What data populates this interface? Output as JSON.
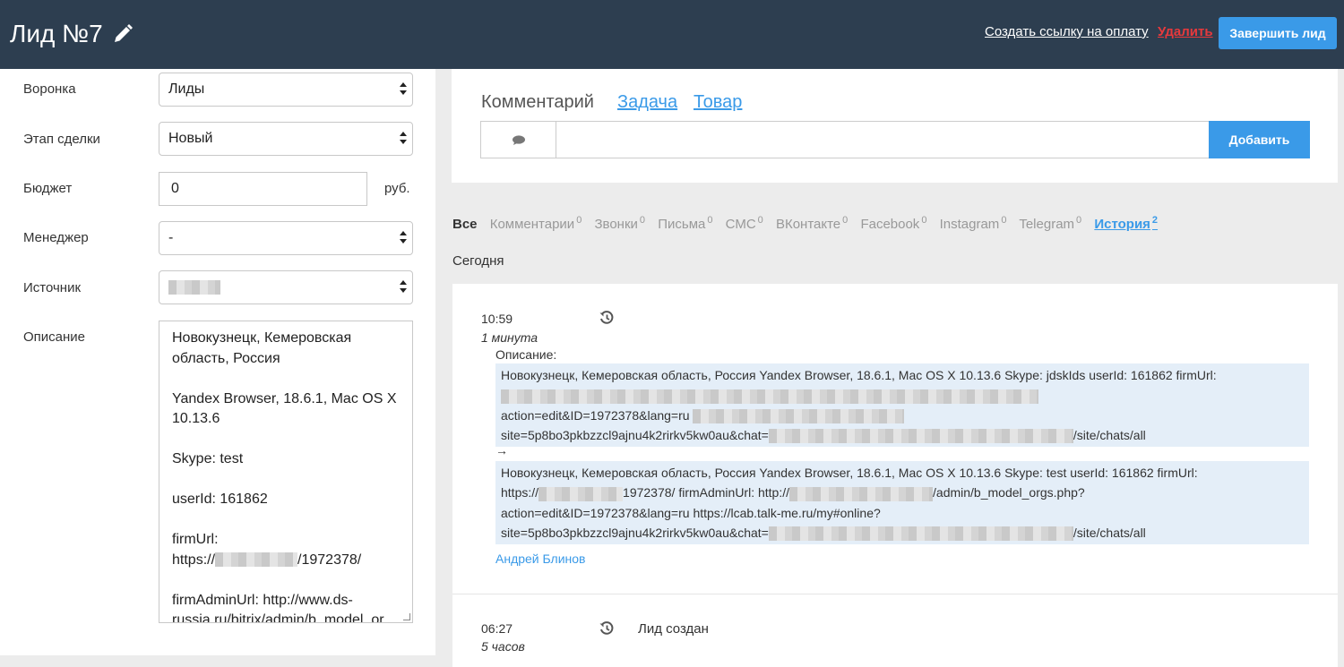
{
  "header": {
    "title": "Лид №7",
    "create_payment_link": "Создать ссылку на оплату",
    "delete_link": "Удалить",
    "finish_button": "Завершить лид"
  },
  "form": {
    "funnel": {
      "label": "Воронка",
      "value": "Лиды"
    },
    "stage": {
      "label": "Этап сделки",
      "value": "Новый"
    },
    "budget": {
      "label": "Бюджет",
      "value": "0",
      "unit": "руб."
    },
    "manager": {
      "label": "Менеджер",
      "value": "-"
    },
    "source": {
      "label": "Источник"
    },
    "description": {
      "label": "Описание",
      "lines": [
        "Новокузнецк, Кемеровская область, Россия",
        "Yandex Browser, 18.6.1, Mac OS X 10.13.6",
        "Skype: test",
        "userId: 161862",
        "firmUrl:",
        "/1972378/",
        "firmAdminUrl: http://www.ds-russia.ru/bitrix/admin/b_model_or"
      ],
      "https_prefix": "https://"
    }
  },
  "comment": {
    "tabs": [
      "Комментарий",
      "Задача",
      "Товар"
    ],
    "input_value": "",
    "input_placeholder": "",
    "add_button": "Добавить"
  },
  "filters": [
    {
      "label": "Все",
      "count": ""
    },
    {
      "label": "Комментарии",
      "count": "0"
    },
    {
      "label": "Звонки",
      "count": "0"
    },
    {
      "label": "Письма",
      "count": "0"
    },
    {
      "label": "СМС",
      "count": "0"
    },
    {
      "label": "ВКонтакте",
      "count": "0"
    },
    {
      "label": "Facebook",
      "count": "0"
    },
    {
      "label": "Instagram",
      "count": "0"
    },
    {
      "label": "Telegram",
      "count": "0"
    },
    {
      "label": "История",
      "count": "2"
    }
  ],
  "today_label": "Сегодня",
  "events": [
    {
      "time": "10:59",
      "ago": "1 минута",
      "icon": "history-icon",
      "desc_label": "Описание:",
      "old_line1": "Новокузнецк, Кемеровская область, Россия Yandex Browser, 18.6.1, Mac OS X 10.13.6 Skype: jdskIds userId: 161862 firmUrl:",
      "old_line3": "action=edit&ID=1972378&lang=ru",
      "old_line4a": "site=5p8bo3pkbzzcl9ajnu4k2rirkv5kw0au&chat=",
      "old_line4b": "/site/chats/all",
      "arrow": "→",
      "new_line1": "Новокузнецк, Кемеровская область, Россия Yandex Browser, 18.6.1, Mac OS X 10.13.6 Skype: test userId: 161862 firmUrl:",
      "new_line2a": "https://",
      "new_line2b": "1972378/ firmAdminUrl: http://",
      "new_line2c": "/admin/b_model_orgs.php?",
      "new_line3": "action=edit&ID=1972378&lang=ru https://lcab.talk-me.ru/my#online?",
      "new_line4a": "site=5p8bo3pkbzzcl9ajnu4k2rirkv5kw0au&chat=",
      "new_line4b": "/site/chats/all",
      "author": "Андрей Блинов"
    },
    {
      "time": "06:27",
      "ago": "5 часов",
      "icon": "history-icon",
      "text": "Лид создан"
    }
  ]
}
